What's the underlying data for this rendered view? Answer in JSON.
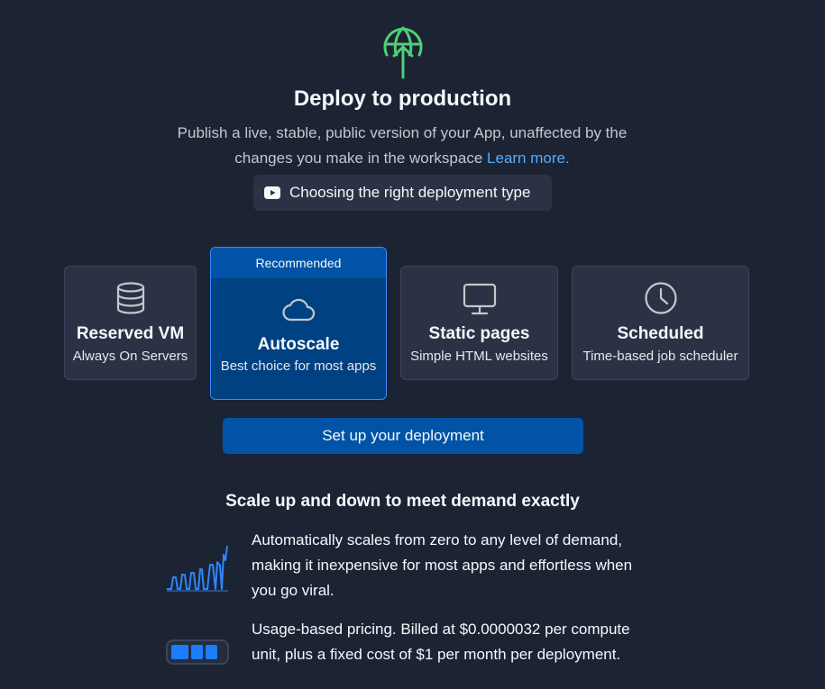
{
  "hero": {
    "icon": "globe-upload-icon",
    "title": "Deploy to production",
    "subtitle": "Publish a live, stable, public version of your App, unaffected by the changes you make in the workspace",
    "learn_more": "Learn more.",
    "video_label": "Choosing the right deployment type"
  },
  "deployment_types": [
    {
      "id": "reserved-vm",
      "icon": "database-icon",
      "title": "Reserved VM",
      "subtitle": "Always On Servers"
    },
    {
      "id": "autoscale",
      "icon": "cloud-icon",
      "badge": "Recommended",
      "title": "Autoscale",
      "subtitle": "Best choice for most apps",
      "selected": true
    },
    {
      "id": "static-pages",
      "icon": "monitor-icon",
      "title": "Static pages",
      "subtitle": "Simple HTML websites"
    },
    {
      "id": "scheduled",
      "icon": "clock-icon",
      "title": "Scheduled",
      "subtitle": "Time-based job scheduler"
    }
  ],
  "cta_label": "Set up your deployment",
  "details": {
    "heading": "Scale up and down to meet demand exactly",
    "features": [
      {
        "icon": "scaling-chart-icon",
        "text": "Automatically scales from zero to any level of demand, making it inexpensive for most apps and effortless when you go viral."
      },
      {
        "icon": "battery-icon",
        "text": "Usage-based pricing. Billed at $0.0000032 per compute unit, plus a fixed cost of $1 per month per deployment."
      }
    ]
  },
  "colors": {
    "background": "#1c2333",
    "card": "#2b3245",
    "accent_green": "#4fcf78",
    "link": "#57abff",
    "primary": "#0053a6",
    "selected_card": "#004182",
    "selected_border": "#3d8bff"
  }
}
